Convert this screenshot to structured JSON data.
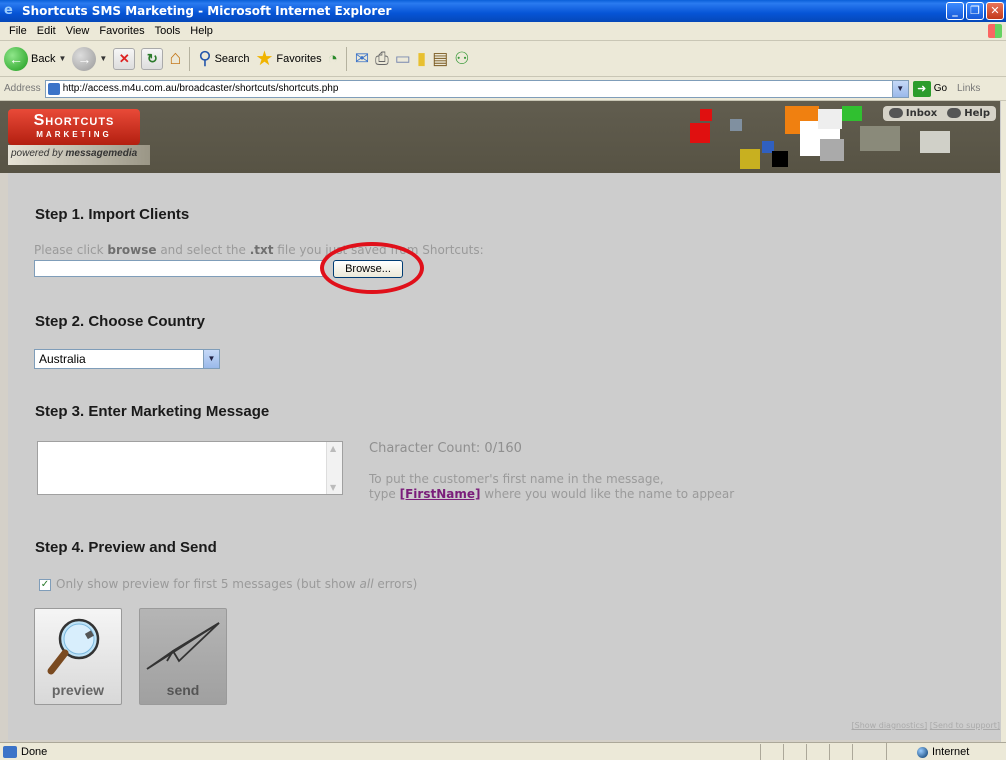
{
  "window": {
    "title": "Shortcuts SMS Marketing - Microsoft Internet Explorer"
  },
  "menu": [
    "File",
    "Edit",
    "View",
    "Favorites",
    "Tools",
    "Help"
  ],
  "toolbar": {
    "back": "Back",
    "search": "Search",
    "favorites": "Favorites"
  },
  "address": {
    "label": "Address",
    "url": "http://access.m4u.com.au/broadcaster/shortcuts/shortcuts.php",
    "go": "Go",
    "links": "Links"
  },
  "header": {
    "logo_title": "Shortcuts",
    "logo_sub": "MARKETING",
    "powered_prefix": "powered by ",
    "powered_brand": "messagemedia",
    "inbox": "Inbox",
    "help": "Help"
  },
  "step1": {
    "title": "Step 1. Import Clients",
    "hint_a": "Please click ",
    "hint_b": "browse",
    "hint_c": " and select the ",
    "hint_d": ".txt",
    "hint_e": " file you just saved from Shortcuts:",
    "browse_label": "Browse..."
  },
  "step2": {
    "title": "Step 2. Choose Country",
    "country": "Australia"
  },
  "step3": {
    "title": "Step 3. Enter Marketing Message",
    "char_count": "Character Count: 0/160",
    "help_line1": "To put the customer's first name in the message,",
    "help_type": "type ",
    "help_token": "[FirstName]",
    "help_rest": " where you would like the name to appear"
  },
  "step4": {
    "title": "Step 4. Preview and Send",
    "checkbox_label_a": "Only show preview for first 5 messages (but show ",
    "checkbox_label_b": "all",
    "checkbox_label_c": " errors)",
    "checked": true,
    "preview_label": "preview",
    "send_label": "send"
  },
  "footer": {
    "diagnostics": "[Show diagnostics]",
    "support": "[Send to support]"
  },
  "status": {
    "text": "Done",
    "zone": "Internet"
  },
  "colors": {
    "title_blue": "#0654d6",
    "logo_red": "#d33420",
    "highlight_red": "#e0101a",
    "page_bg": "#cdcdcd"
  }
}
